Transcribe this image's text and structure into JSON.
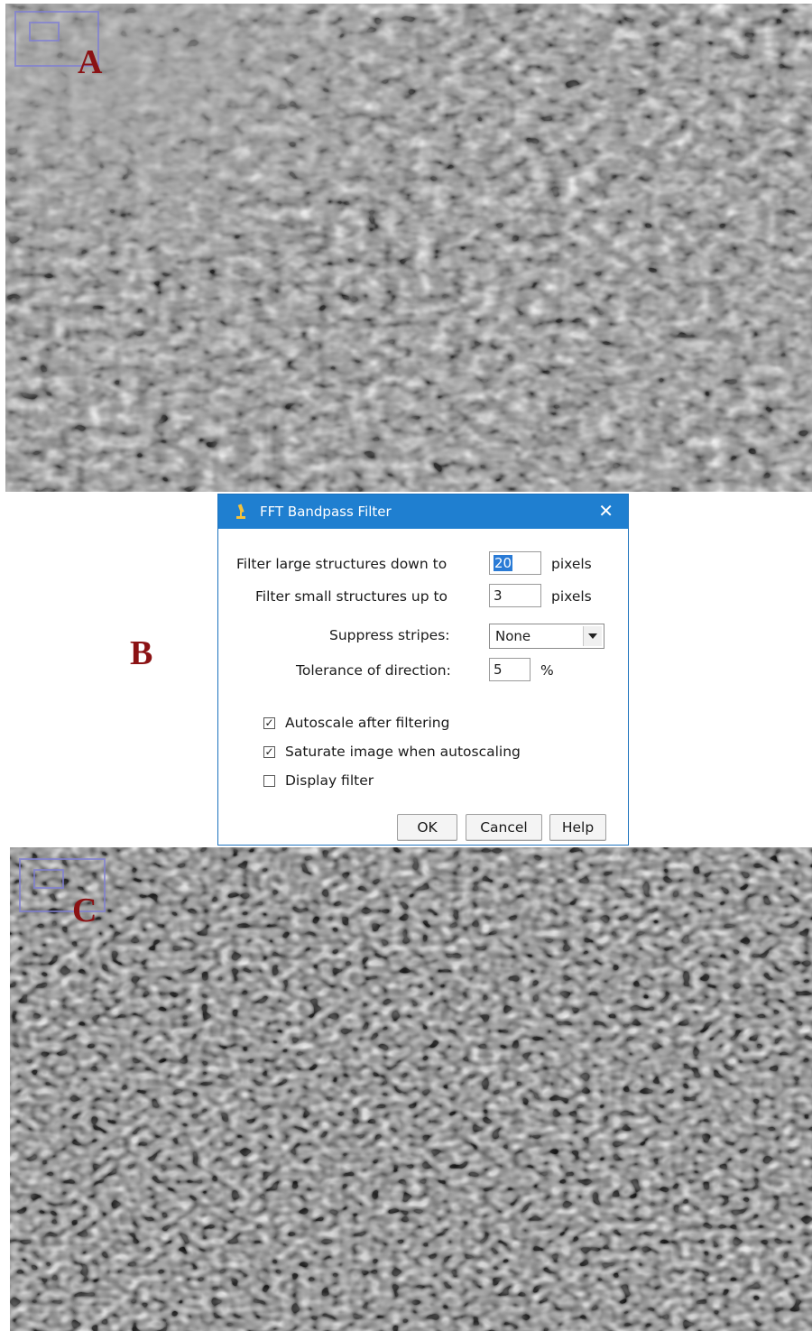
{
  "labels": {
    "a": "A",
    "b": "B",
    "c": "C"
  },
  "dialog": {
    "title": "FFT Bandpass Filter",
    "close_icon": "close-icon",
    "app_icon": "microscope-icon",
    "large_label": "Filter large structures down to",
    "large_value_selected": "20",
    "large_unit": "pixels",
    "small_label": "Filter small structures up to",
    "small_value": "3",
    "small_unit": "pixels",
    "stripes_label": "Suppress stripes:",
    "stripes_value": "None",
    "tolerance_label": "Tolerance of direction:",
    "tolerance_value": "5",
    "tolerance_unit": "%",
    "checks": [
      {
        "label": "Autoscale after filtering",
        "checked": true
      },
      {
        "label": "Saturate image when autoscaling",
        "checked": true
      },
      {
        "label": "Display filter",
        "checked": false
      }
    ],
    "buttons": {
      "ok": "OK",
      "cancel": "Cancel",
      "help": "Help"
    }
  },
  "colors": {
    "title_bar": "#1f7fd0",
    "label_text": "#8b1214",
    "selection": "#2a7bd6"
  }
}
